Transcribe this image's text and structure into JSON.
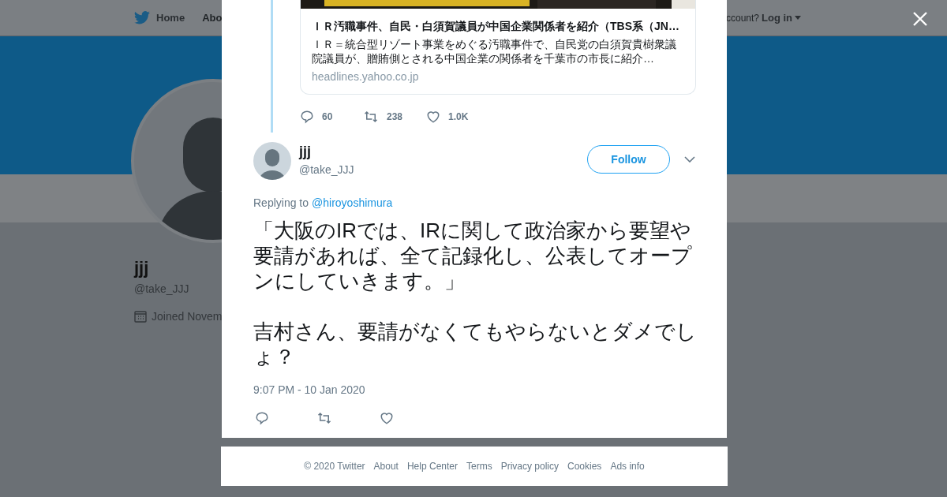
{
  "background_page": {
    "nav": {
      "items": [
        "Home",
        "Abo"
      ],
      "account_prompt": "ccount?",
      "login": "Log in"
    },
    "profile": {
      "name": "jjj",
      "handle": "@take_JJJ",
      "joined": "Joined Novem"
    }
  },
  "modal": {
    "quoted_card": {
      "kind": "picture",
      "title": "ＩＲ汚職事件、自民・白須賀議員が中国企業関係者を紹介（TBS系（JN…",
      "description": "ＩＲ＝統合型リゾート事業をめぐる汚職事件で、自民党の白須賀貴樹衆議院議員が、贈賄側とされる中国企業の関係者を千葉市の市長に紹介…",
      "domain": "headlines.yahoo.co.jp"
    },
    "parent_actions": {
      "replies": "60",
      "retweets": "238",
      "likes": "1.0K"
    },
    "tweet": {
      "name": "jjj",
      "handle": "@take_JJJ",
      "follow": "Follow",
      "replying_label": "Replying to",
      "replying_to": "@hiroyoshimura",
      "paragraphs": [
        "「大阪のIRでは、IRに関して政治家から要望や要請があれば、全て記録化し、公表してオープンにしていきます。」",
        "吉村さん、要請がなくてもやらないとダメでしょ？"
      ],
      "timestamp": "9:07 PM - 10 Jan 2020"
    }
  },
  "footer": [
    "© 2020 Twitter",
    "About",
    "Help Center",
    "Terms",
    "Privacy policy",
    "Cookies",
    "Ads info"
  ]
}
